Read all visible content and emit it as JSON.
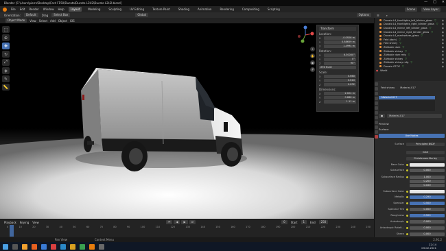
{
  "window": {
    "title": "Blender [C:\\Users\\pierre\\Desktop\\Ford F150\\Ducato\\Ducato L2H2\\Ducato L2H2.blend]",
    "controls": [
      "—",
      "□",
      "✕"
    ]
  },
  "menu": {
    "items": [
      "File",
      "Edit",
      "Render",
      "Window",
      "Help"
    ],
    "workspaces": [
      "Layout",
      "Modeling",
      "Sculpting",
      "UV Editing",
      "Texture Paint",
      "Shading",
      "Animation",
      "Rendering",
      "Compositing",
      "Scripting"
    ],
    "active_workspace": "Layout",
    "scene": "Scene",
    "view_layer": "View Layer"
  },
  "header": {
    "mode_orientation": "Orientation:",
    "default": "Default",
    "drag": "Drag",
    "select_box": "Select Box",
    "global": "Global",
    "options": "Options"
  },
  "viewport_header": {
    "mode": "Object Mode",
    "menus": [
      "View",
      "Select",
      "Add",
      "Object",
      "GIS"
    ]
  },
  "npanel": {
    "title": "Transform",
    "location_label": "Location:",
    "location": [
      {
        "axis": "X",
        "value": "-0.0926 m"
      },
      {
        "axis": "Y",
        "value": "0.88659 m"
      },
      {
        "axis": "Z",
        "value": "1.4994 m"
      }
    ],
    "rotation_label": "Rotation:",
    "rotation": [
      {
        "axis": "X",
        "value": "6.30000°"
      },
      {
        "axis": "Y",
        "value": "0°"
      },
      {
        "axis": "Z",
        "value": "90°"
      }
    ],
    "rotation_mode": "XYZ Euler",
    "scale_label": "Scale:",
    "scale": [
      {
        "axis": "X",
        "value": "0.660"
      },
      {
        "axis": "Y",
        "value": "0.610"
      },
      {
        "axis": "Z",
        "value": "0.632"
      }
    ],
    "dimensions_label": "Dimensions:",
    "dimensions": [
      {
        "axis": "X",
        "value": "2.024 m"
      },
      {
        "axis": "Y",
        "value": "0.686 m"
      },
      {
        "axis": "Z",
        "value": "1.11 m"
      }
    ]
  },
  "outliner": {
    "items": [
      "Ducato L4_frontlights_left_blinker_glass",
      "Ducato L4_frontlights_right_blinker_glass",
      "Ducato L4_mirror_left_blinker_glass",
      "Ducato L4_mirror_right_blinker_glass",
      "Ducato L4_marksetzer_glass",
      "Feld (dark)",
      "Feld shiney",
      "Zähtoblr dark",
      "Zähtoblr shiney",
      "Zähtoblr dark mfg",
      "Zähtoblr shiney",
      "Zähtoblr shiney mfg",
      "Ducato GTOP"
    ],
    "world": "World"
  },
  "properties": {
    "material_slot": "Feld shiney",
    "material_name": "Material.017",
    "material_list": [
      "Material.017"
    ],
    "preview_label": "Preview",
    "surface_label": "Surface",
    "use_nodes": "Use Nodes",
    "surface": "Principled BSDF",
    "distribution": "GGX",
    "subsurface_method": "Christensen-Burley",
    "rows": [
      {
        "label": "Base Color",
        "value": ""
      },
      {
        "label": "Subsurface",
        "value": "0.000"
      },
      {
        "label": "Subsurface Radius",
        "value": "1.000"
      },
      {
        "label": "",
        "value": "0.200"
      },
      {
        "label": "",
        "value": "0.100"
      },
      {
        "label": "Subsurface Color",
        "value": ""
      },
      {
        "label": "Metallic",
        "value": "0.290"
      },
      {
        "label": "Specular",
        "value": "0.500"
      },
      {
        "label": "Specular Tint",
        "value": "0.000"
      },
      {
        "label": "Roughness",
        "value": "0.500"
      },
      {
        "label": "Anisotropic",
        "value": "0.000"
      },
      {
        "label": "Anisotropic Rotati...",
        "value": "0.000"
      },
      {
        "label": "Sheen",
        "value": "0.000"
      }
    ]
  },
  "timeline": {
    "playback": "Playback",
    "keying": "Keying",
    "view": "View",
    "frame": "0",
    "start_label": "Start",
    "start": "1",
    "end_label": "End",
    "end": "250",
    "ticks": [
      "0",
      "10",
      "20",
      "30",
      "40",
      "50",
      "60",
      "70",
      "80",
      "90",
      "100",
      "110",
      "120",
      "130",
      "140",
      "150",
      "160",
      "170",
      "180",
      "190",
      "200",
      "210",
      "220",
      "230",
      "240",
      "250"
    ]
  },
  "status": {
    "left": "Pan View",
    "mid": "Context Menu",
    "version": "2.91.2"
  },
  "clock": {
    "time": "22:14",
    "date": "03.02.2021"
  },
  "colors": {
    "accent": "#4772b3",
    "orange": "#e87d0d"
  }
}
